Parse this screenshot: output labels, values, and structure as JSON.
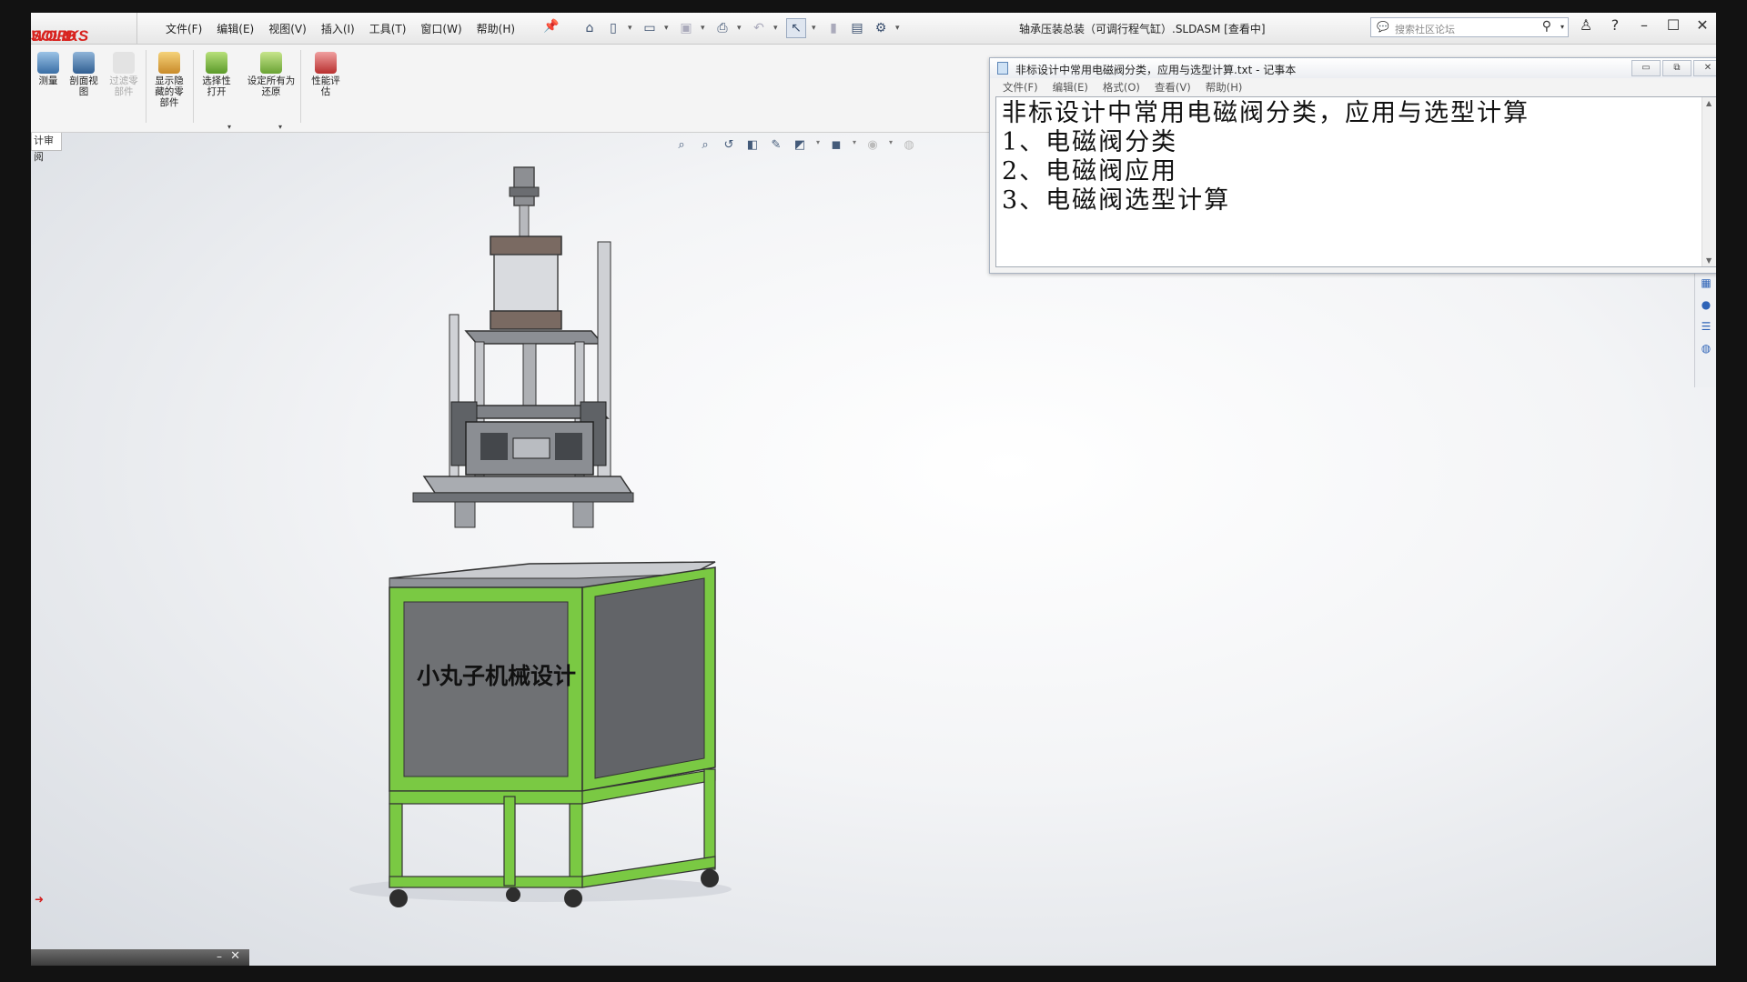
{
  "app": {
    "logo_part1": "SOLID",
    "logo_part2": "WORKS",
    "document_title": "轴承压装总装（可调行程气缸）.SLDASM [查看中]"
  },
  "menu": [
    "文件(F)",
    "编辑(E)",
    "视图(V)",
    "插入(I)",
    "工具(T)",
    "窗口(W)",
    "帮助(H)"
  ],
  "search": {
    "placeholder": "搜索社区论坛"
  },
  "ribbon": {
    "measure": "测量",
    "section_view": "剖面视图",
    "filter_parts": "过滤零部件",
    "show_hidden_parts": "显示隐藏的零部件",
    "selective_open": "选择性打开",
    "set_all_restore": "设定所有为还原",
    "performance_eval": "性能评估"
  },
  "feature_tab": "计审阅",
  "notepad": {
    "title": "非标设计中常用电磁阀分类，应用与选型计算.txt - 记事本",
    "menu": [
      "文件(F)",
      "编辑(E)",
      "格式(O)",
      "查看(V)",
      "帮助(H)"
    ],
    "lines": [
      "非标设计中常用电磁阀分类，应用与选型计算",
      "1、电磁阀分类",
      "2、电磁阀应用",
      "3、电磁阀选型计算"
    ]
  },
  "model": {
    "panel_label": "小丸子机械设计",
    "frame_color": "#7ac943",
    "panel_color": "#6f7174"
  },
  "colors": {
    "brand_red": "#d8231f",
    "accent_blue": "#1c5fbf"
  },
  "icons": {
    "home": "home-icon",
    "new": "new-document-icon",
    "open": "open-folder-icon",
    "save": "save-icon",
    "print": "print-icon",
    "undo": "undo-icon",
    "select": "select-cursor-icon",
    "options": "gear-icon",
    "search": "search-icon",
    "user": "user-icon",
    "help": "help-icon"
  }
}
